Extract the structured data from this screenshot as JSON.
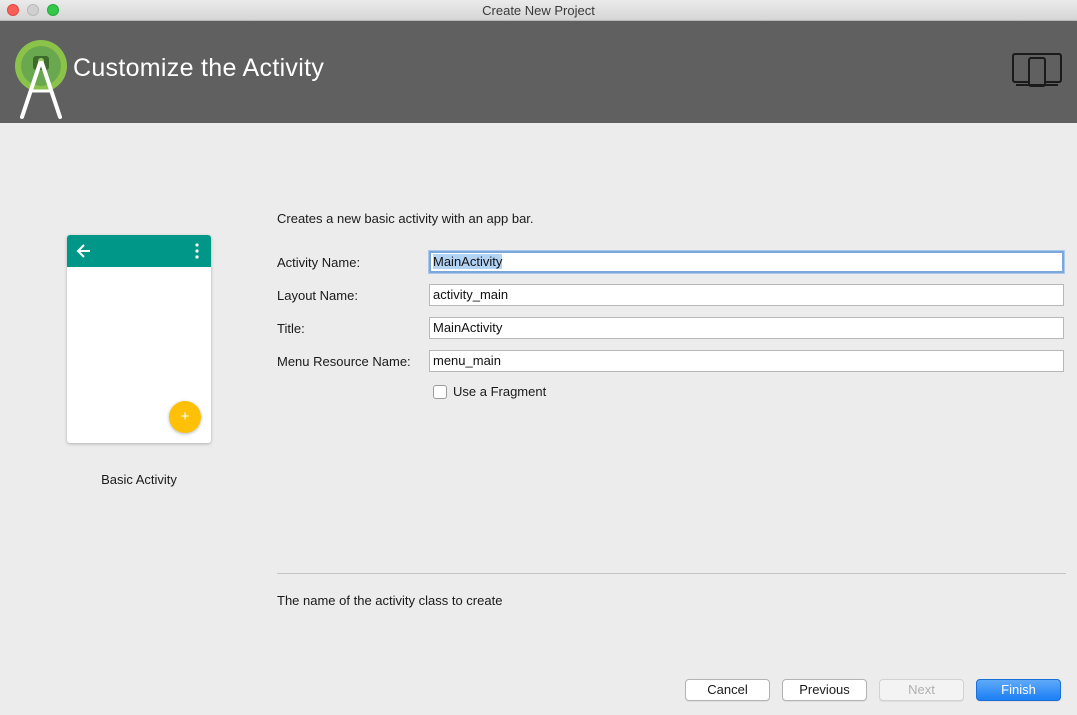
{
  "window": {
    "title": "Create New Project"
  },
  "header": {
    "title": "Customize the Activity",
    "logo_icon": "android-studio-logo-icon",
    "device_icon": "phone-tablet-icon"
  },
  "preview": {
    "label": "Basic Activity",
    "app_bar_color": "#009688",
    "fab_color": "#ffc107",
    "fab_glyph": "+"
  },
  "form": {
    "description": "Creates a new basic activity with an app bar.",
    "fields": [
      {
        "label": "Activity Name:",
        "value": "MainActivity"
      },
      {
        "label": "Layout Name:",
        "value": "activity_main"
      },
      {
        "label": "Title:",
        "value": "MainActivity"
      },
      {
        "label": "Menu Resource Name:",
        "value": "menu_main"
      }
    ],
    "checkbox": {
      "label": "Use a Fragment",
      "checked": false
    },
    "help_text": "The name of the activity class to create"
  },
  "buttons": {
    "cancel": "Cancel",
    "previous": "Previous",
    "next": "Next",
    "finish": "Finish"
  },
  "colors": {
    "header_bg": "#606060",
    "accent": "#1b7ff5"
  }
}
